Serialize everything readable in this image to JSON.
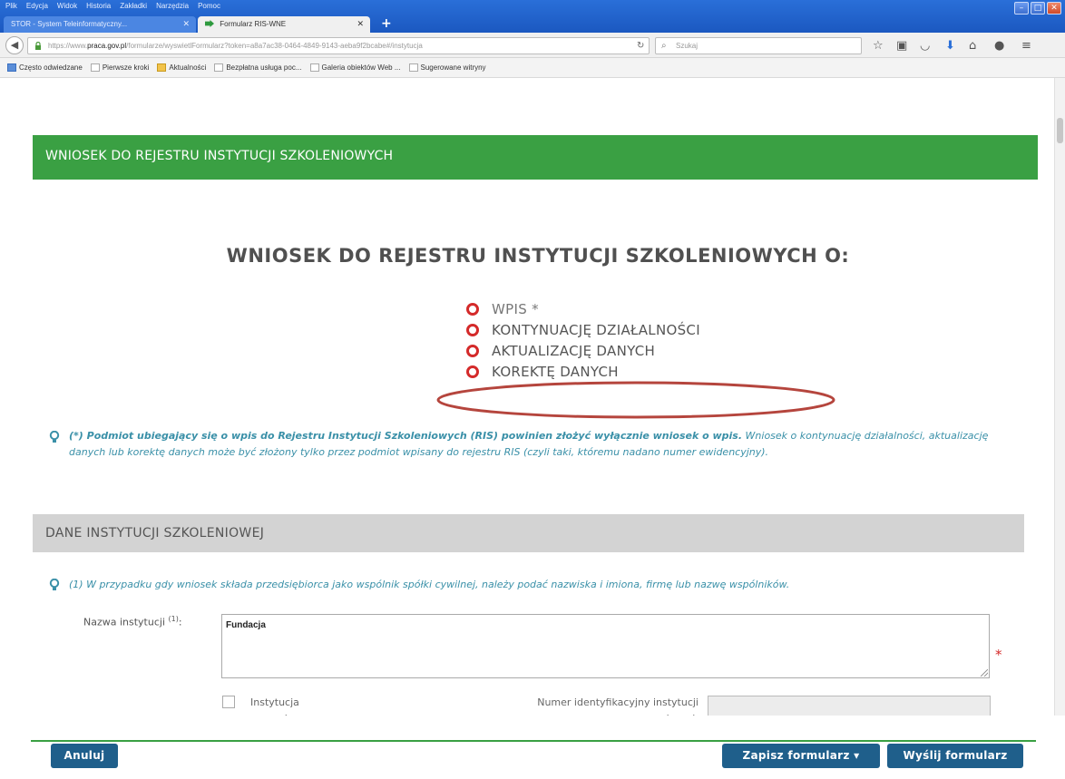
{
  "browser": {
    "menu": [
      "Plik",
      "Edycja",
      "Widok",
      "Historia",
      "Zakładki",
      "Narzędzia",
      "Pomoc"
    ],
    "tabs": [
      {
        "label": "STOR - System Teleinformatyczny..."
      },
      {
        "label": "Formularz RIS-WNE"
      }
    ],
    "url_prefix": "https://www.",
    "url_domain": "praca.gov.pl",
    "url_rest": "/formularze/wyswietlFormularz?token=a8a7ac38-0464-4849-9143-aeba9f2bcabe#/instytucja",
    "search_placeholder": "Szukaj",
    "bookmarks": [
      {
        "label": "Często odwiedzane",
        "icon": "blue"
      },
      {
        "label": "Pierwsze kroki",
        "icon": "plain"
      },
      {
        "label": "Aktualności",
        "icon": "yellow"
      },
      {
        "label": "Bezpłatna usługa poc...",
        "icon": "plain"
      },
      {
        "label": "Galeria obiektów Web ...",
        "icon": "plain"
      },
      {
        "label": "Sugerowane witryny",
        "icon": "plain"
      }
    ]
  },
  "header": {
    "title": "WNIOSEK DO REJESTRU INSTYTUCJI SZKOLENIOWYCH"
  },
  "form": {
    "title": "WNIOSEK DO REJESTRU INSTYTUCJI SZKOLENIOWYCH O:",
    "options": [
      {
        "label": "WPIS *"
      },
      {
        "label": "KONTYNUACJĘ DZIAŁALNOŚCI"
      },
      {
        "label": "AKTUALIZACJĘ DANYCH"
      },
      {
        "label": "KOREKTĘ DANYCH"
      }
    ],
    "notice_bold": "(*) Podmiot ubiegający się o wpis do Rejestru Instytucji Szkoleniowych (RIS) powinien złożyć wyłącznie wniosek o wpis.",
    "notice_rest": " Wniosek o kontynuację działalności, aktualizację danych lub korektę danych może być złożony tylko przez podmiot wpisany do rejestru RIS (czyli taki, któremu nadano numer ewidencyjny).",
    "section_title": "DANE INSTYTUCJI SZKOLENIOWEJ",
    "notice2": "(1) W przypadku gdy wniosek składa przedsiębiorca jako wspólnik spółki cywilnej, należy podać nazwiska i imiona, firmę lub nazwę wspólników.",
    "name_label": "Nazwa instytucji",
    "name_label_sup": "(1)",
    "name_value": "Fundacja",
    "required_mark": "*",
    "foreign_label": "Instytucja zagraniczna",
    "foreign_id_label": "Numer identyfikacyjny instytucji zagranicznej:",
    "foreign_id_value": ""
  },
  "actions": {
    "cancel": "Anuluj",
    "save": "Zapisz formularz ▾",
    "send": "Wyślij formularz"
  },
  "colors": {
    "green": "#3aa043",
    "radio_red": "#d42a2a",
    "button_blue": "#1f5f8b",
    "notice_teal": "#3a90a8",
    "annotation_ellipse": "#b5453d"
  }
}
